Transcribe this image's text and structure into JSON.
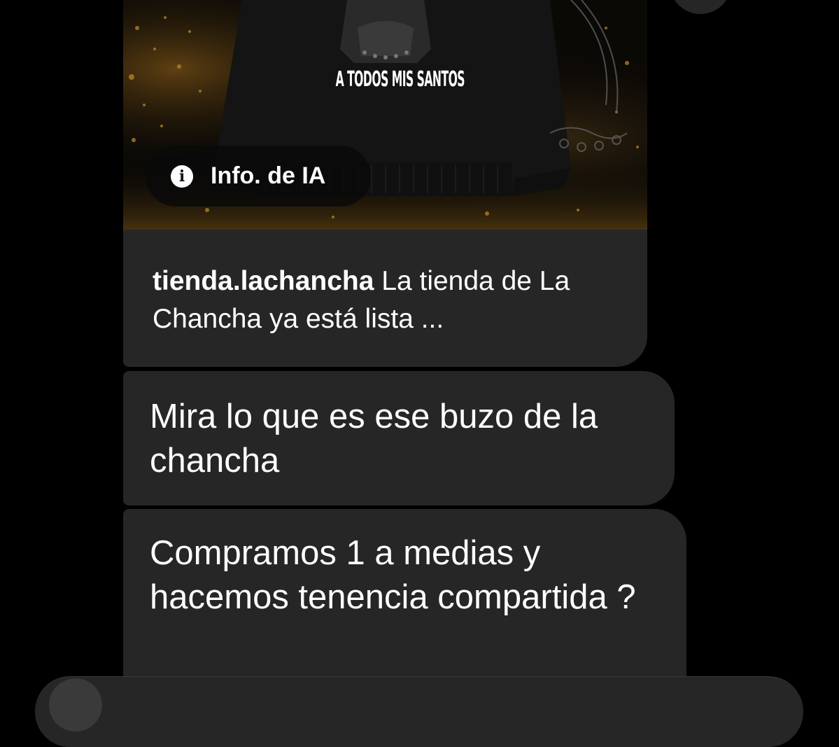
{
  "post": {
    "poster_text": "A TODOS MIS SANTOS",
    "ai_info_label": "Info. de IA",
    "caption_username": "tienda.lachancha",
    "caption_text": " La tienda de La Chancha ya está lista ..."
  },
  "messages": [
    {
      "text": "Mira lo que es ese buzo de la chancha"
    },
    {
      "text": "Compramos 1 a medias y hacemos tenencia compartida ?"
    }
  ],
  "icons": {
    "info": "info-icon",
    "camera": "camera-icon"
  },
  "colors": {
    "background": "#000000",
    "bubble": "#262626",
    "text": "#ffffff",
    "poster_accent": "#a8771f"
  }
}
